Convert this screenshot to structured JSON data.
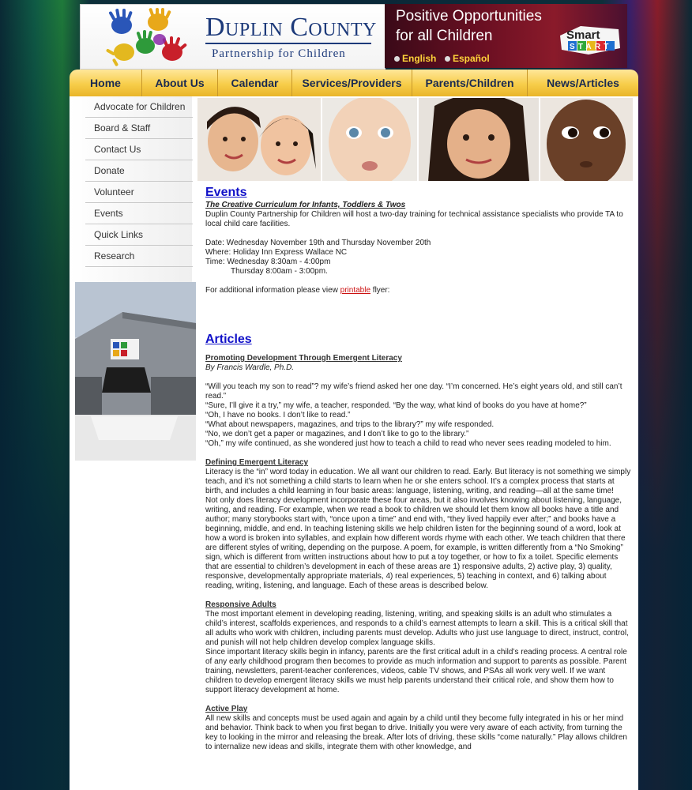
{
  "header": {
    "title": "Duplin County",
    "subtitle": "Partnership for Children",
    "tagline_1": "Positive Opportunities",
    "tagline_2": "for all Children",
    "lang_english": "English",
    "lang_espanol": "Español",
    "smart": "Smart",
    "start": "START"
  },
  "nav": [
    {
      "label": "Home"
    },
    {
      "label": "About Us"
    },
    {
      "label": "Calendar"
    },
    {
      "label": "Services/Providers"
    },
    {
      "label": "Parents/Children"
    },
    {
      "label": "News/Articles"
    }
  ],
  "sidebar": [
    {
      "label": "Advocate for Children"
    },
    {
      "label": "Board & Staff"
    },
    {
      "label": "Contact Us"
    },
    {
      "label": "Donate"
    },
    {
      "label": "Volunteer"
    },
    {
      "label": "Events"
    },
    {
      "label": "Quick Links"
    },
    {
      "label": "Research"
    }
  ],
  "events": {
    "heading": "Events",
    "title": "The Creative Curriculum for Infants, Toddlers & Twos",
    "desc": "Duplin County Partnership for Children will host a two-day training for technical assistance specialists who provide TA to local child care facilities.",
    "date": "Date: Wednesday November 19th and Thursday November 20th",
    "where": "Where: Holiday Inn Express Wallace NC",
    "time1": "Time: Wednesday 8:30am - 4:00pm",
    "time2": "Thursday 8:00am - 3:00pm.",
    "info_pre": "For additional information please view ",
    "info_link": "printable",
    "info_post": " flyer:"
  },
  "articles": {
    "heading": "Articles",
    "a1_title": "Promoting Development Through Emergent Literacy",
    "a1_author": "By Francis Wardle, Ph.D.",
    "q1": "“Will you teach my son to read”? my wife’s friend asked her one day. “I’m concerned. He’s eight years old, and still can’t read.”",
    "q2": "“Sure, I’ll give it a try,” my wife, a teacher, responded. “By the way, what kind of books do you have at home?”",
    "q3": "“Oh, I have no books. I don’t like to read.”",
    "q4": "“What about newspapers, magazines, and trips to the library?” my wife responded.",
    "q5": "“No, we don’t get a paper or magazines, and I don’t like to go to the library.”",
    "q6": "“Oh,” my wife continued, as she wondered just how to teach a child to read who never sees reading modeled to him.",
    "s1_title": "Defining Emergent Literacy",
    "s1_p1": "Literacy is the “in” word today in education. We all want our children to read. Early. But literacy is not something we simply teach, and it’s not something a child starts to learn when he or she enters school. It’s a complex process that starts at birth, and includes a child learning in four basic areas: language, listening, writing, and reading—all at the same time!",
    "s1_p2": "Not only does literacy development incorporate these four areas, but it also involves knowing about listening, language, writing, and reading. For example, when we read a book to children we should let them know all books have a title and author; many storybooks start with, “once upon a time” and end with, “they lived happily ever after;” and books have a beginning, middle, and end. In teaching listening skills we help children listen for the beginning sound of a word, look at how a word is broken into syllables, and explain how different words rhyme with each other. We teach children that there are different styles of writing, depending on the purpose. A poem, for example, is written differently from a “No Smoking” sign, which is different from written instructions about how to put a toy together, or how to fix a toilet. Specific elements that are essential to children’s development in each of these areas are 1) responsive adults, 2) active play, 3) quality, responsive, developmentally appropriate materials, 4) real experiences, 5) teaching in context, and 6) talking about reading, writing, listening, and language. Each of these areas is described below.",
    "s2_title": "Responsive Adults",
    "s2_p1": "The most important element in developing reading, listening, writing, and speaking skills is an adult who stimulates a child’s interest, scaffolds experiences, and responds to a child’s earnest attempts to learn a skill. This is a critical skill that all adults who work with children, including parents must develop. Adults who just use language to direct, instruct, control, and punish will not help children develop complex language skills.",
    "s2_p2": "Since important literacy skills begin in infancy, parents are the first critical adult in a child’s reading process. A central role of any early childhood program then becomes to provide as much information and support to parents as possible. Parent training, newsletters, parent-teacher conferences, videos, cable TV shows, and PSAs all work very well. If we want children to develop emergent literacy skills we must help parents understand their critical role, and show them how to support literacy development at home.",
    "s3_title": "Active Play",
    "s3_p1": "All new skills and concepts must be used again and again by a child until they become fully integrated in his or her mind and behavior. Think back to when you first began to drive. Initially you were very aware of each activity, from turning the key to looking in the mirror and releasing the break. After lots of driving, these skills “come naturally.” Play allows children to internalize new ideas and skills, integrate them with other knowledge, and"
  }
}
